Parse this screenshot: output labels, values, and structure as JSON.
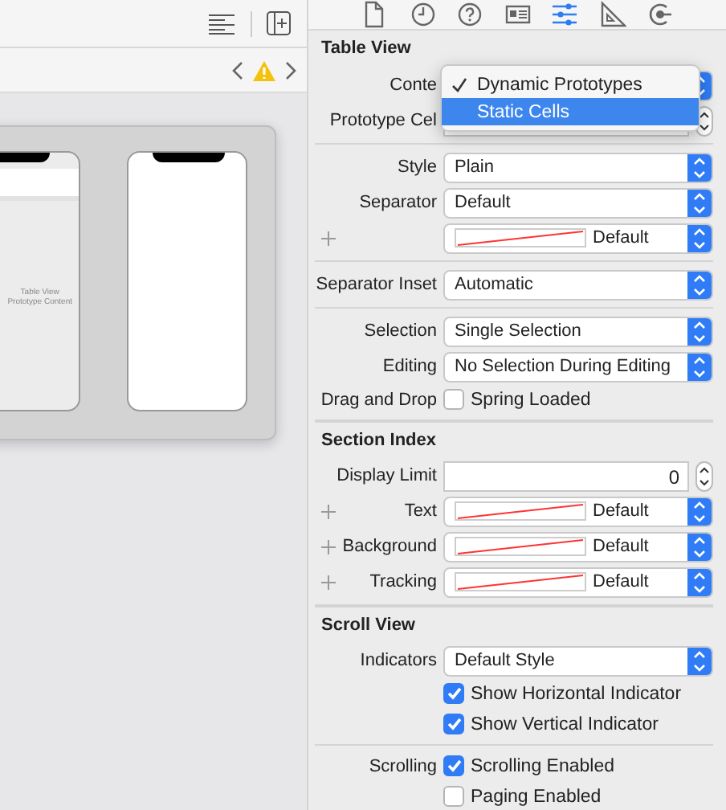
{
  "canvas": {
    "warning": true,
    "scene_texts": [
      "Table View",
      "Prototype Content"
    ]
  },
  "inspector_tabs": [
    {
      "kind": "file",
      "selected": false
    },
    {
      "kind": "clock",
      "selected": false
    },
    {
      "kind": "help",
      "selected": false
    },
    {
      "kind": "identity",
      "selected": false
    },
    {
      "kind": "attributes",
      "selected": true
    },
    {
      "kind": "size",
      "selected": false
    },
    {
      "kind": "connections",
      "selected": false
    }
  ],
  "sections": [
    {
      "title": "Table View",
      "groups": [
        [
          {
            "kind": "popup",
            "label": "Conte"
          },
          {
            "kind": "stepper",
            "label": "Prototype Cel"
          }
        ],
        [
          {
            "kind": "popup",
            "label": "Style",
            "value": "Plain"
          },
          {
            "kind": "popup",
            "label": "Separator",
            "value": "Default"
          },
          {
            "kind": "color",
            "value": "Default"
          }
        ],
        [
          {
            "kind": "popup",
            "label": "Separator Inset",
            "value": "Automatic"
          }
        ],
        [
          {
            "kind": "popup",
            "label": "Selection",
            "value": "Single Selection"
          },
          {
            "kind": "popup",
            "label": "Editing",
            "value": "No Selection During Editing"
          },
          {
            "kind": "checkbox",
            "label": "Drag and Drop",
            "text": "Spring Loaded",
            "checked": false
          }
        ]
      ]
    },
    {
      "title": "Section Index",
      "groups": [
        [
          {
            "kind": "stepper",
            "label": "Display Limit",
            "value": "0"
          },
          {
            "kind": "color",
            "label": "Text",
            "value": "Default"
          },
          {
            "kind": "color",
            "label": "Background",
            "value": "Default"
          },
          {
            "kind": "color",
            "label": "Tracking",
            "value": "Default"
          }
        ]
      ]
    },
    {
      "title": "Scroll View",
      "groups": [
        [
          {
            "kind": "popup",
            "label": "Indicators",
            "value": "Default Style"
          },
          {
            "kind": "checkbox",
            "text": "Show Horizontal Indicator",
            "checked": true
          },
          {
            "kind": "checkbox",
            "text": "Show Vertical Indicator",
            "checked": true
          }
        ],
        [
          {
            "kind": "checkbox",
            "label": "Scrolling",
            "text": "Scrolling Enabled",
            "checked": true
          },
          {
            "kind": "checkbox",
            "text": "Paging Enabled",
            "checked": false
          }
        ]
      ]
    }
  ],
  "menu": {
    "items": [
      {
        "label": "Dynamic Prototypes",
        "checked": true,
        "selected": false
      },
      {
        "label": "Static Cells",
        "checked": false,
        "selected": true
      }
    ]
  }
}
